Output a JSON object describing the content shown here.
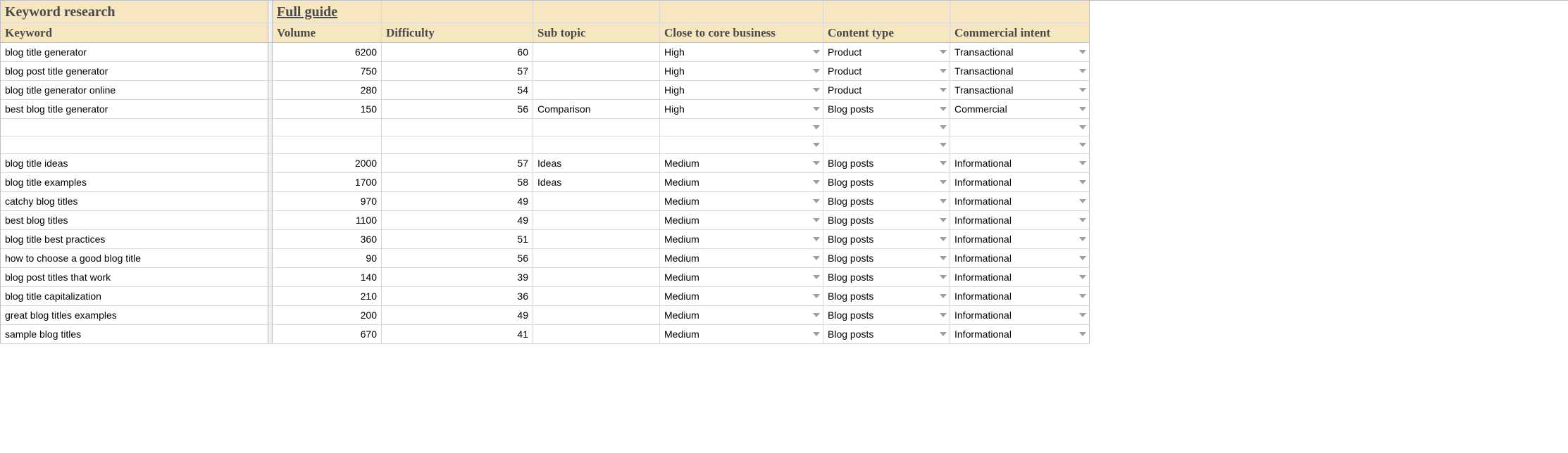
{
  "title": "Keyword research",
  "link_label": "Full guide",
  "headers": [
    "Keyword",
    "Volume",
    "Difficulty",
    "Sub topic",
    "Close to core business",
    "Content type",
    "Commercial intent"
  ],
  "rows": [
    {
      "keyword": "blog title generator",
      "volume": "6200",
      "difficulty": "60",
      "subtopic": "",
      "close": "High",
      "content_type": "Product",
      "intent": "Transactional"
    },
    {
      "keyword": "blog post title generator",
      "volume": "750",
      "difficulty": "57",
      "subtopic": "",
      "close": "High",
      "content_type": "Product",
      "intent": "Transactional"
    },
    {
      "keyword": "blog title generator online",
      "volume": "280",
      "difficulty": "54",
      "subtopic": "",
      "close": "High",
      "content_type": "Product",
      "intent": "Transactional"
    },
    {
      "keyword": "best blog title generator",
      "volume": "150",
      "difficulty": "56",
      "subtopic": "Comparison",
      "close": "High",
      "content_type": "Blog posts",
      "intent": "Commercial"
    },
    {
      "keyword": "",
      "volume": "",
      "difficulty": "",
      "subtopic": "",
      "close": "",
      "content_type": "",
      "intent": ""
    },
    {
      "keyword": "",
      "volume": "",
      "difficulty": "",
      "subtopic": "",
      "close": "",
      "content_type": "",
      "intent": ""
    },
    {
      "keyword": "blog title ideas",
      "volume": "2000",
      "difficulty": "57",
      "subtopic": "Ideas",
      "close": "Medium",
      "content_type": "Blog posts",
      "intent": "Informational"
    },
    {
      "keyword": "blog title examples",
      "volume": "1700",
      "difficulty": "58",
      "subtopic": "Ideas",
      "close": "Medium",
      "content_type": "Blog posts",
      "intent": "Informational"
    },
    {
      "keyword": "catchy blog titles",
      "volume": "970",
      "difficulty": "49",
      "subtopic": "",
      "close": "Medium",
      "content_type": "Blog posts",
      "intent": "Informational"
    },
    {
      "keyword": "best blog titles",
      "volume": "1100",
      "difficulty": "49",
      "subtopic": "",
      "close": "Medium",
      "content_type": "Blog posts",
      "intent": "Informational"
    },
    {
      "keyword": "blog title best practices",
      "volume": "360",
      "difficulty": "51",
      "subtopic": "",
      "close": "Medium",
      "content_type": "Blog posts",
      "intent": "Informational"
    },
    {
      "keyword": "how to choose a good blog title",
      "volume": "90",
      "difficulty": "56",
      "subtopic": "",
      "close": "Medium",
      "content_type": "Blog posts",
      "intent": "Informational"
    },
    {
      "keyword": "blog post titles that work",
      "volume": "140",
      "difficulty": "39",
      "subtopic": "",
      "close": "Medium",
      "content_type": "Blog posts",
      "intent": "Informational"
    },
    {
      "keyword": "blog title capitalization",
      "volume": "210",
      "difficulty": "36",
      "subtopic": "",
      "close": "Medium",
      "content_type": "Blog posts",
      "intent": "Informational"
    },
    {
      "keyword": "great blog titles examples",
      "volume": "200",
      "difficulty": "49",
      "subtopic": "",
      "close": "Medium",
      "content_type": "Blog posts",
      "intent": "Informational"
    },
    {
      "keyword": "sample blog titles",
      "volume": "670",
      "difficulty": "41",
      "subtopic": "",
      "close": "Medium",
      "content_type": "Blog posts",
      "intent": "Informational"
    }
  ]
}
